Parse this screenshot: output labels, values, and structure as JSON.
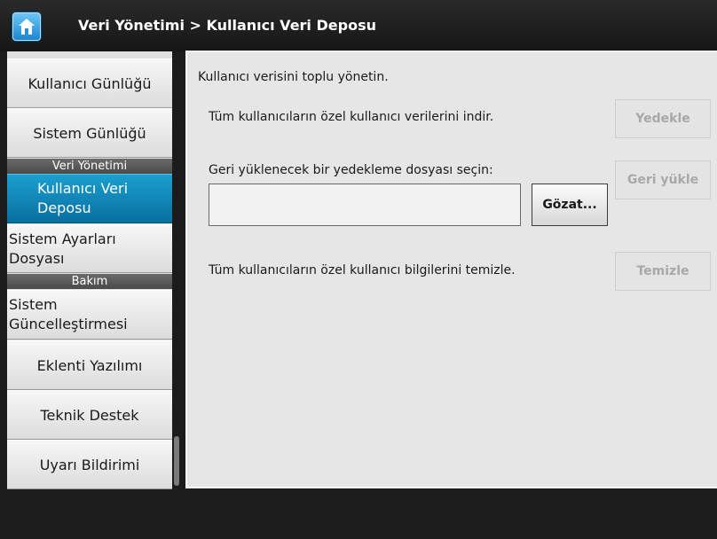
{
  "header": {
    "title": "Veri Yönetimi > Kullanıcı Veri Deposu",
    "home_icon": "home-icon"
  },
  "sidebar": {
    "items": [
      {
        "label": "Kullanıcı Günlüğü"
      },
      {
        "label": "Sistem Günlüğü"
      },
      {
        "section": "Veri Yönetimi"
      },
      {
        "label": "Kullanıcı Veri Deposu",
        "selected": true
      },
      {
        "label": "Sistem Ayarları Dosyası"
      },
      {
        "section": "Bakım"
      },
      {
        "label": "Sistem Güncelleştirmesi"
      },
      {
        "label": "Eklenti Yazılımı"
      },
      {
        "label": "Teknik Destek"
      },
      {
        "label": "Uyarı Bildirimi"
      }
    ]
  },
  "main": {
    "intro": "Kullanıcı verisini toplu yönetin.",
    "backup": {
      "text": "Tüm kullanıcıların özel kullanıcı verilerini indir.",
      "button": "Yedekle"
    },
    "restore": {
      "text": "Geri yüklenecek bir yedekleme dosyası seçin:",
      "file_value": "",
      "browse": "Gözat...",
      "button": "Geri yükle"
    },
    "clear": {
      "text": "Tüm kullanıcıların özel kullanıcı bilgilerini temizle.",
      "button": "Temizle"
    }
  },
  "colors": {
    "selected": "#0a6f9f",
    "section_header": "#5a5a5a",
    "background": "#e6e6e6"
  }
}
